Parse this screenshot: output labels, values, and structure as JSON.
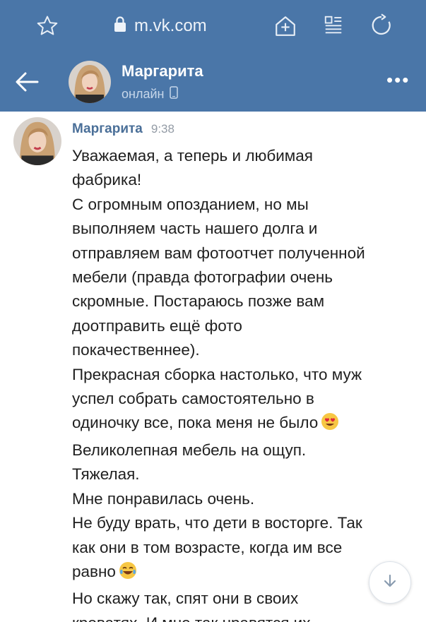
{
  "browser": {
    "url": "m.vk.com"
  },
  "header": {
    "name": "Маргарита",
    "status": "онлайн"
  },
  "message": {
    "sender": "Маргарита",
    "time": "9:38",
    "lines": [
      "Уважаемая, а теперь и любимая",
      "фабрика!",
      "С огромным опозданием, но мы",
      "выполняем часть нашего долга и",
      "отправляем вам фотоотчет полученной",
      "мебели (правда фотографии очень",
      "скромные. Постараюсь позже вам",
      "доотправить ещё фото",
      "покачественнее).",
      "Прекрасная сборка настолько, что муж",
      "успел собрать самостоятельно в",
      "одиночку все, пока меня не было",
      "Великолепная мебель на ощуп.",
      "Тяжелая.",
      "Мне понравилась очень.",
      "Не буду врать, что дети в восторге. Так",
      "как они в том возрасте, когда им все",
      "равно",
      "Но скажу так, спят они в своих",
      "кроватях. И мне так нравятся их"
    ]
  },
  "icons": {
    "favorite": "star-icon",
    "lock": "lock-icon",
    "home": "add-to-home-icon",
    "reader": "reader-mode-icon",
    "reload": "reload-icon",
    "back": "back-arrow-icon",
    "phone": "mobile-phone-icon",
    "more": "more-icon",
    "heart_eyes": "heart-eyes-emoji",
    "tears_of_joy": "tears-of-joy-emoji",
    "scroll_down": "arrow-down-icon"
  },
  "colors": {
    "header_bg": "#4a76a8",
    "sender_name": "#4a6f98",
    "text": "#1f1f1f",
    "time": "#939ba5"
  }
}
